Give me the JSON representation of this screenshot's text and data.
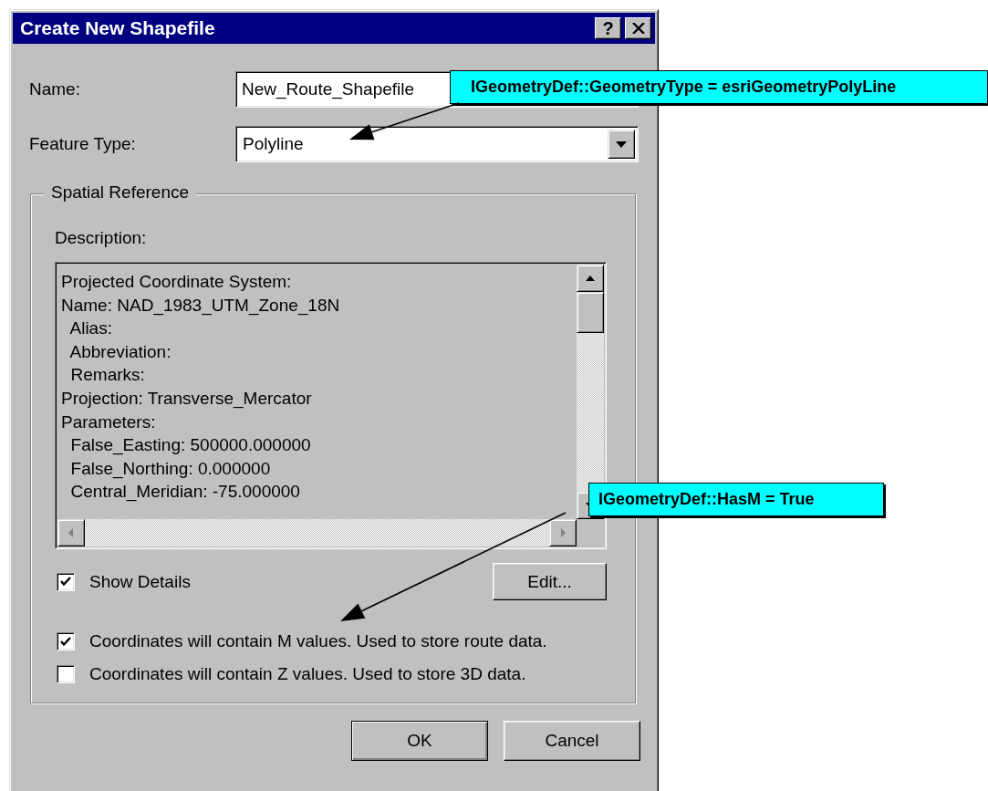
{
  "window": {
    "title": "Create New Shapefile",
    "help_button": "?"
  },
  "name_field": {
    "label": "Name:",
    "value": "New_Route_Shapefile"
  },
  "feature_type": {
    "label": "Feature Type:",
    "value": "Polyline"
  },
  "spatial_reference": {
    "title": "Spatial Reference",
    "description_label": "Description:",
    "description_lines": [
      "Projected Coordinate System:",
      "Name: NAD_1983_UTM_Zone_18N",
      "  Alias:",
      "  Abbreviation:",
      "  Remarks:",
      "Projection: Transverse_Mercator",
      "Parameters:",
      "  False_Easting: 500000.000000",
      "  False_Northing: 0.000000",
      "  Central_Meridian: -75.000000"
    ],
    "show_details": {
      "label": "Show Details",
      "checked": true
    },
    "edit_button": "Edit..."
  },
  "options": [
    {
      "label": "Coordinates will contain M values. Used to store route data.",
      "checked": true
    },
    {
      "label": "Coordinates will contain Z values. Used to store 3D data.",
      "checked": false
    }
  ],
  "buttons": [
    "OK",
    "Cancel"
  ],
  "callouts": [
    {
      "text": "IGeometryDef::GeometryType = esriGeometryPolyLine"
    },
    {
      "text": "IGeometryDef::HasM = True"
    }
  ]
}
